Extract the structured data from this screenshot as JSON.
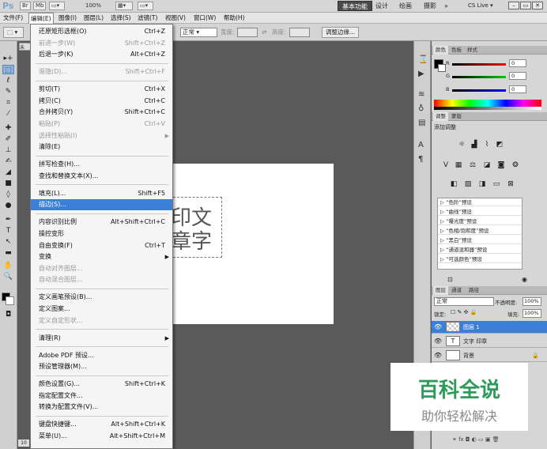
{
  "appbar": {
    "logo": "Ps",
    "br": "Br",
    "mb": "Mb",
    "zoom": "100%",
    "workspaces": [
      "基本功能",
      "设计",
      "绘画",
      "摄影",
      "»"
    ],
    "cs_live": "CS Live ▾"
  },
  "menubar": [
    "文件(F)",
    "编辑(E)",
    "图像(I)",
    "图层(L)",
    "选择(S)",
    "滤镜(T)",
    "视图(V)",
    "窗口(W)",
    "帮助(H)"
  ],
  "options": {
    "mode_value": "正常",
    "width_label": "宽度:",
    "height_label": "高度:",
    "refine_edge": "调整边缘..."
  },
  "doc_tab": "未",
  "doc_status_zoom": "10",
  "canvas_text": {
    "line1": "印文",
    "line2": "章字"
  },
  "edit_menu": [
    {
      "label": "还原矩形选框(O)",
      "shortcut": "Ctrl+Z",
      "disabled": false
    },
    {
      "label": "前进一步(W)",
      "shortcut": "Shift+Ctrl+Z",
      "disabled": true
    },
    {
      "label": "后退一步(K)",
      "shortcut": "Alt+Ctrl+Z",
      "disabled": false
    },
    {
      "label": "渐隐(D)...",
      "shortcut": "Shift+Ctrl+F",
      "disabled": true
    },
    {
      "label": "剪切(T)",
      "shortcut": "Ctrl+X",
      "disabled": false
    },
    {
      "label": "拷贝(C)",
      "shortcut": "Ctrl+C",
      "disabled": false
    },
    {
      "label": "合并拷贝(Y)",
      "shortcut": "Shift+Ctrl+C",
      "disabled": false
    },
    {
      "label": "粘贴(P)",
      "shortcut": "Ctrl+V",
      "disabled": true
    },
    {
      "label": "选择性粘贴(I)",
      "shortcut": "",
      "disabled": true,
      "submenu": true
    },
    {
      "label": "清除(E)",
      "shortcut": "",
      "disabled": false
    },
    {
      "label": "拼写检查(H)...",
      "shortcut": "",
      "disabled": false
    },
    {
      "label": "查找和替换文本(X)...",
      "shortcut": "",
      "disabled": false
    },
    {
      "label": "填充(L)...",
      "shortcut": "Shift+F5",
      "disabled": false
    },
    {
      "label": "描边(S)...",
      "shortcut": "",
      "disabled": false,
      "highlighted": true
    },
    {
      "label": "内容识别比例",
      "shortcut": "Alt+Shift+Ctrl+C",
      "disabled": false
    },
    {
      "label": "操控变形",
      "shortcut": "",
      "disabled": false
    },
    {
      "label": "自由变换(F)",
      "shortcut": "Ctrl+T",
      "disabled": false
    },
    {
      "label": "变换",
      "shortcut": "",
      "disabled": false,
      "submenu": true
    },
    {
      "label": "自动对齐图层...",
      "shortcut": "",
      "disabled": true
    },
    {
      "label": "自动混合图层...",
      "shortcut": "",
      "disabled": true
    },
    {
      "label": "定义画笔预设(B)...",
      "shortcut": "",
      "disabled": false
    },
    {
      "label": "定义图案...",
      "shortcut": "",
      "disabled": false
    },
    {
      "label": "定义自定形状...",
      "shortcut": "",
      "disabled": true
    },
    {
      "label": "清理(R)",
      "shortcut": "",
      "disabled": false,
      "submenu": true
    },
    {
      "label": "Adobe PDF 预设...",
      "shortcut": "",
      "disabled": false
    },
    {
      "label": "预设管理器(M)...",
      "shortcut": "",
      "disabled": false
    },
    {
      "label": "颜色设置(G)...",
      "shortcut": "Shift+Ctrl+K",
      "disabled": false
    },
    {
      "label": "指定配置文件...",
      "shortcut": "",
      "disabled": false
    },
    {
      "label": "转换为配置文件(V)...",
      "shortcut": "",
      "disabled": false
    },
    {
      "label": "键盘快捷键...",
      "shortcut": "Alt+Shift+Ctrl+K",
      "disabled": false
    },
    {
      "label": "菜单(U)...",
      "shortcut": "Alt+Shift+Ctrl+M",
      "disabled": false
    }
  ],
  "color_panel": {
    "tabs": [
      "颜色",
      "色板",
      "样式"
    ],
    "channels": [
      {
        "name": "R",
        "value": "0",
        "color": "#d00000"
      },
      {
        "name": "G",
        "value": "0",
        "color": "#00a000"
      },
      {
        "name": "B",
        "value": "0",
        "color": "#0030d0"
      }
    ]
  },
  "adjust_panel": {
    "tabs": [
      "调整",
      "蒙版"
    ],
    "title": "添加调整",
    "presets": [
      "“色阶”预设",
      "“曲线”预设",
      "“曝光度”预设",
      "“色相/饱和度”预设",
      "“黑白”预设",
      "“通道混和器”预设",
      "“可选颜色”预设"
    ]
  },
  "layers_panel": {
    "tabs": [
      "图层",
      "通道",
      "路径"
    ],
    "blend_mode": "正常",
    "opacity_label": "不透明度:",
    "opacity_value": "100%",
    "lock_label": "锁定:",
    "fill_label": "填充:",
    "fill_value": "100%",
    "layers": [
      {
        "name": "图层 1",
        "kind": "pixel",
        "selected": true
      },
      {
        "name": "文字 印章",
        "kind": "text",
        "selected": false
      },
      {
        "name": "背景",
        "kind": "background",
        "selected": false
      }
    ]
  },
  "watermark": {
    "line1": "百科全说",
    "line2": "助你轻松解决"
  }
}
